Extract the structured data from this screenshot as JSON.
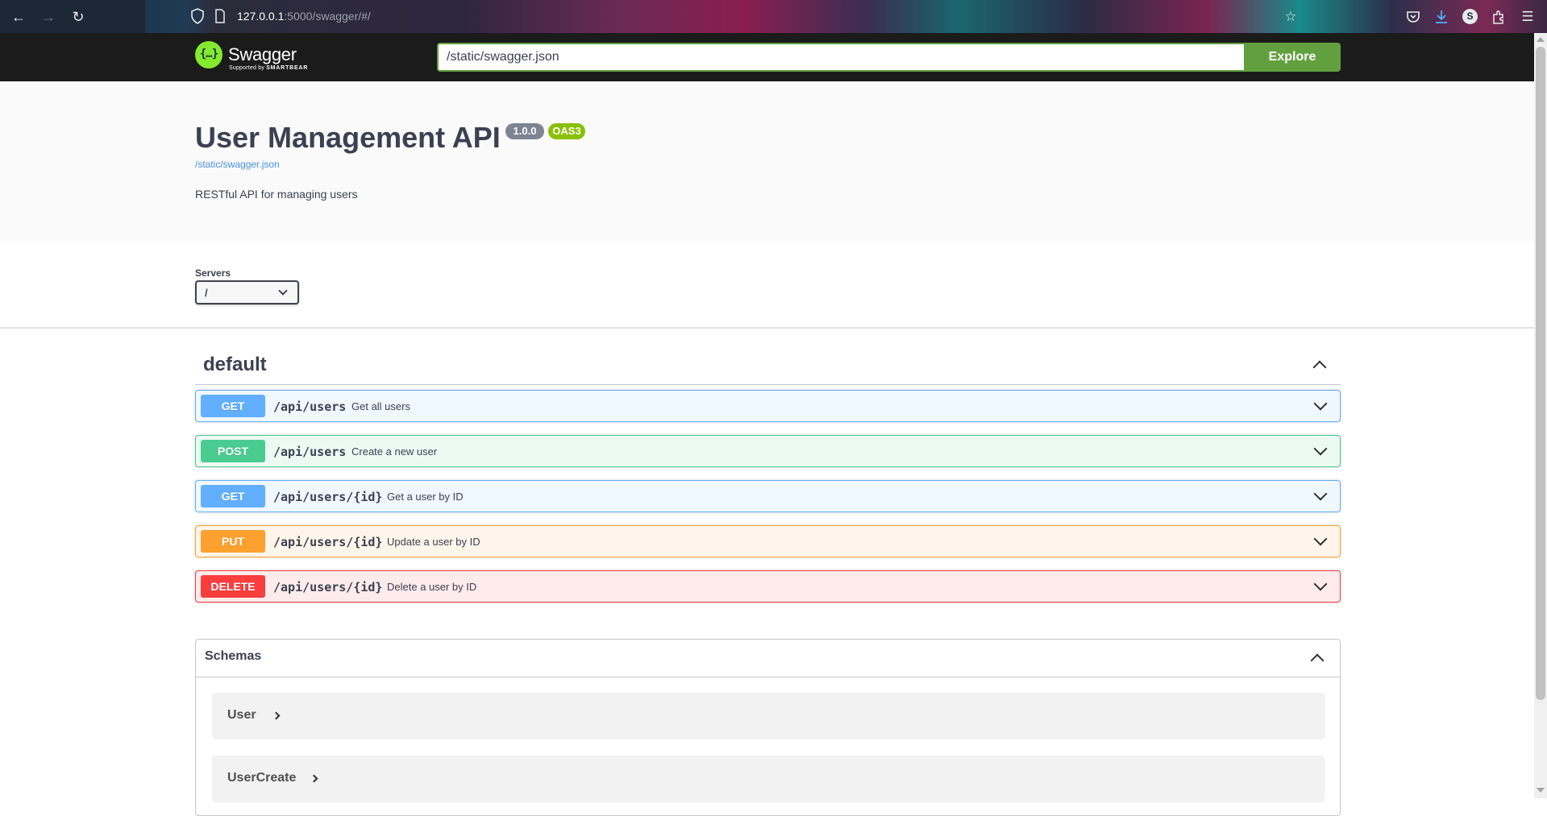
{
  "browser": {
    "url_host": "127.0.0.1",
    "url_rest": ":5000/swagger/#/",
    "profile_initial": "S",
    "nav_icons": [
      "arrow-left-icon",
      "arrow-right-icon",
      "reload-icon"
    ],
    "toolbar_icons": [
      "bookmark-star-icon",
      "pocket-icon",
      "downloads-icon",
      "extensions-icon",
      "menu-icon"
    ]
  },
  "topbar": {
    "logo_glyph": "{…}",
    "logo_word": "Swagger",
    "logo_sub_prefix": "Supported by",
    "logo_sub_brand": "SMARTBEAR",
    "spec_url": "/static/swagger.json",
    "explore_label": "Explore"
  },
  "info": {
    "title": "User Management API",
    "version": "1.0.0",
    "oas_badge": "OAS3",
    "spec_link": "/static/swagger.json",
    "description": "RESTful API for managing users"
  },
  "servers": {
    "label": "Servers",
    "selected": "/"
  },
  "tag": {
    "name": "default"
  },
  "operations": [
    {
      "method": "GET",
      "path": "/api/users",
      "summary": "Get all users"
    },
    {
      "method": "POST",
      "path": "/api/users",
      "summary": "Create a new user"
    },
    {
      "method": "GET",
      "path": "/api/users/{id}",
      "summary": "Get a user by ID"
    },
    {
      "method": "PUT",
      "path": "/api/users/{id}",
      "summary": "Update a user by ID"
    },
    {
      "method": "DELETE",
      "path": "/api/users/{id}",
      "summary": "Delete a user by ID"
    }
  ],
  "schemas": {
    "title": "Schemas",
    "models": [
      "User",
      "UserCreate"
    ]
  },
  "colors": {
    "get": "#61affe",
    "post": "#49cc90",
    "put": "#fca130",
    "delete": "#f93e3e",
    "explore": "#62a03f",
    "oas_badge": "#89bf04",
    "version_badge": "#7d8492"
  }
}
